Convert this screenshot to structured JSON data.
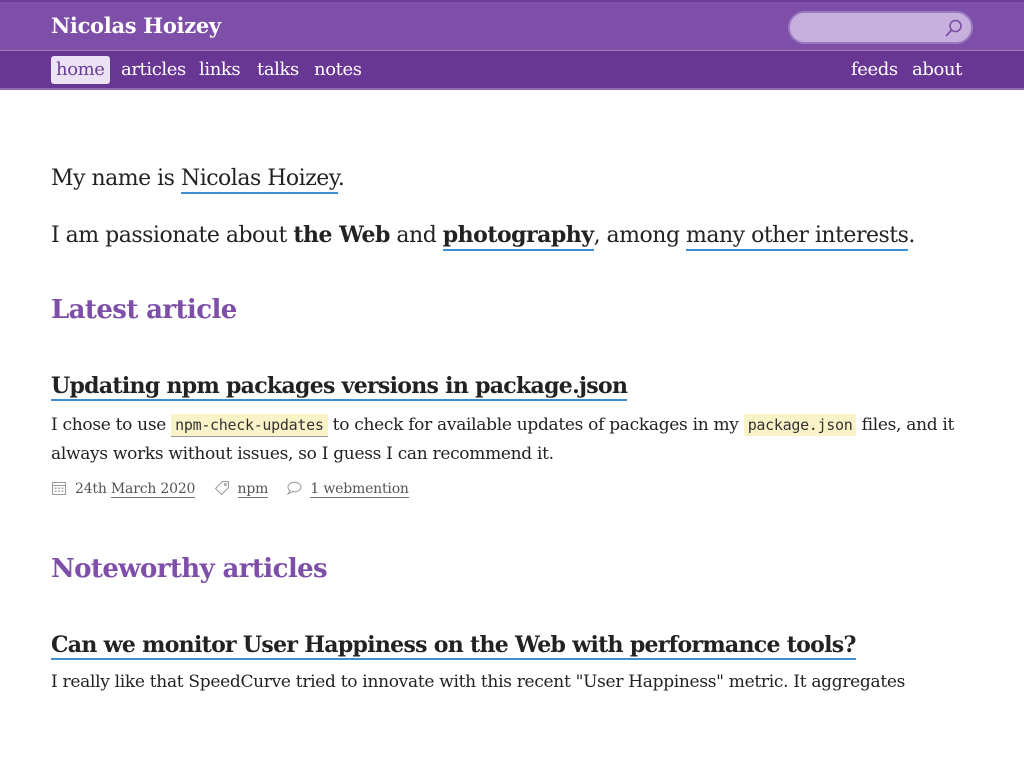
{
  "header": {
    "site_title": "Nicolas Hoizey",
    "search_placeholder": ""
  },
  "nav": {
    "left": [
      {
        "label": "home",
        "active": true
      },
      {
        "label": "articles"
      },
      {
        "label": "links"
      },
      {
        "label": "talks"
      },
      {
        "label": "notes"
      }
    ],
    "right": [
      {
        "label": "feeds"
      },
      {
        "label": "about"
      }
    ]
  },
  "intro": {
    "line1_prefix": "My name is ",
    "line1_link": "Nicolas Hoizey",
    "line1_suffix": ".",
    "line2_prefix": "I am passionate about ",
    "line2_strong": "the Web",
    "line2_mid": " and ",
    "line2_link_strong": "photography",
    "line2_mid2": ", among ",
    "line2_link": "many other interests",
    "line2_suffix": "."
  },
  "latest": {
    "heading": "Latest article",
    "title": "Updating npm packages versions in package.json",
    "excerpt_1": "I chose to use ",
    "code_1": "npm-check-updates",
    "excerpt_2": " to check for available updates of packages in my ",
    "code_2": "package.json",
    "excerpt_3": " files, and it always works without issues, so I guess I can recommend it.",
    "date_prefix": "24th ",
    "date_link": "March 2020",
    "tag": "npm",
    "mentions": "1 webmention"
  },
  "noteworthy": {
    "heading": "Noteworthy articles",
    "title": "Can we monitor User Happiness on the Web with performance tools?",
    "excerpt": "I really like that SpeedCurve tried to innovate with this recent \"User Happiness\" metric. It aggregates"
  },
  "colors": {
    "brand": "#7e4fa8",
    "nav_bg": "#683693",
    "link_underline": "#3d8fd1",
    "code_bg": "#fbf3c8"
  },
  "icons": [
    "search-icon",
    "calendar-icon",
    "tag-icon",
    "comment-icon"
  ]
}
